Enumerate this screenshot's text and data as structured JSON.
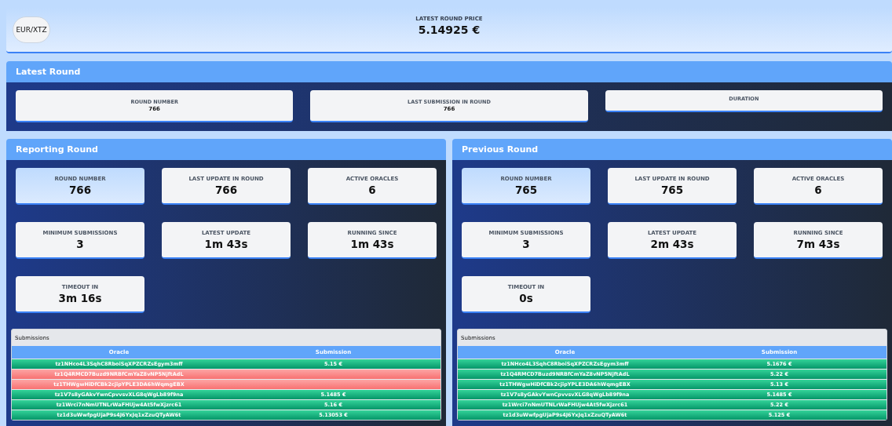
{
  "header": {
    "pair_button": "EUR/XTZ",
    "price_label": "LATEST ROUND PRICE",
    "price": "5.14925 €"
  },
  "latest_round": {
    "title": "Latest Round",
    "cards": [
      {
        "label": "ROUND NUMBER",
        "value": "766"
      },
      {
        "label": "LAST SUBMISSION IN ROUND",
        "value": "766"
      },
      {
        "label": "DURATION"
      }
    ]
  },
  "rounds": [
    {
      "title": "Reporting Round",
      "cards": [
        {
          "label": "ROUND NUMBER",
          "value": "766",
          "highlighted": true
        },
        {
          "label": "LAST UPDATE IN ROUND",
          "value": "766",
          "highlighted": false
        },
        {
          "label": "ACTIVE ORACLES",
          "value": "6",
          "highlighted": false
        },
        {
          "label": "MINIMUM SUBMISSIONS",
          "value": "3",
          "highlighted": false
        },
        {
          "label": "LATEST UPDATE",
          "value": "1m 43s",
          "highlighted": false
        },
        {
          "label": "RUNNING SINCE",
          "value": "1m 43s",
          "highlighted": false
        },
        {
          "label": "TIMEOUT IN",
          "value": "3m 16s",
          "highlighted": false
        }
      ],
      "submissions": {
        "title": "Submissions",
        "columns": [
          "Oracle",
          "Submission"
        ],
        "rows": [
          {
            "oracle": "tz1NHco4L3SqhC8RboiSqXPZCRZsEgym3mff",
            "submission": "5.15 €",
            "submitted": true
          },
          {
            "oracle": "tz1Q4RMCD7Buzd9NRBfCmYaZ8vNP5NjftAdL",
            "submitted": false
          },
          {
            "oracle": "tz1THWgwHiDfCBk2cjipYPLE3DA6hWqmgEBX",
            "submitted": false
          },
          {
            "oracle": "tz1V7s8yGAkvYwnCpvvsvXLG8qWgLb89f9na",
            "submission": "5.1485 €",
            "submitted": true
          },
          {
            "oracle": "tz1Wrci7nNmUTNLrWaFHUjw4At5fwXjzrc61",
            "submission": "5.16 €",
            "submitted": true
          },
          {
            "oracle": "tz1d3uWwfpgUjaP9s4J6YxJq1xZzuQTyAW6t",
            "submission": "5.13053 €",
            "submitted": true
          }
        ]
      }
    },
    {
      "title": "Previous Round",
      "cards": [
        {
          "label": "ROUND NUMBER",
          "value": "765",
          "highlighted": true
        },
        {
          "label": "LAST UPDATE IN ROUND",
          "value": "765",
          "highlighted": false
        },
        {
          "label": "ACTIVE ORACLES",
          "value": "6",
          "highlighted": false
        },
        {
          "label": "MINIMUM SUBMISSIONS",
          "value": "3",
          "highlighted": false
        },
        {
          "label": "LATEST UPDATE",
          "value": "2m 43s",
          "highlighted": false
        },
        {
          "label": "RUNNING SINCE",
          "value": "7m 43s",
          "highlighted": false
        },
        {
          "label": "TIMEOUT IN",
          "value": "0s",
          "highlighted": false
        }
      ],
      "submissions": {
        "title": "Submissions",
        "columns": [
          "Oracle",
          "Submission"
        ],
        "rows": [
          {
            "oracle": "tz1NHco4L3SqhC8RboiSqXPZCRZsEgym3mff",
            "submission": "5.1676 €",
            "submitted": true
          },
          {
            "oracle": "tz1Q4RMCD7Buzd9NRBfCmYaZ8vNP5NjftAdL",
            "submission": "5.22 €",
            "submitted": true
          },
          {
            "oracle": "tz1THWgwHiDfCBk2cjipYPLE3DA6hWqmgEBX",
            "submission": "5.13 €",
            "submitted": true
          },
          {
            "oracle": "tz1V7s8yGAkvYwnCpvvsvXLG8qWgLb89f9na",
            "submission": "5.1485 €",
            "submitted": true
          },
          {
            "oracle": "tz1Wrci7nNmUTNLrWaFHUjw4At5fwXjzrc61",
            "submission": "5.22 €",
            "submitted": true
          },
          {
            "oracle": "tz1d3uWwfpgUjaP9s4J6YxJq1xZzuQTyAW6t",
            "submission": "5.125 €",
            "submitted": true
          }
        ]
      }
    }
  ]
}
